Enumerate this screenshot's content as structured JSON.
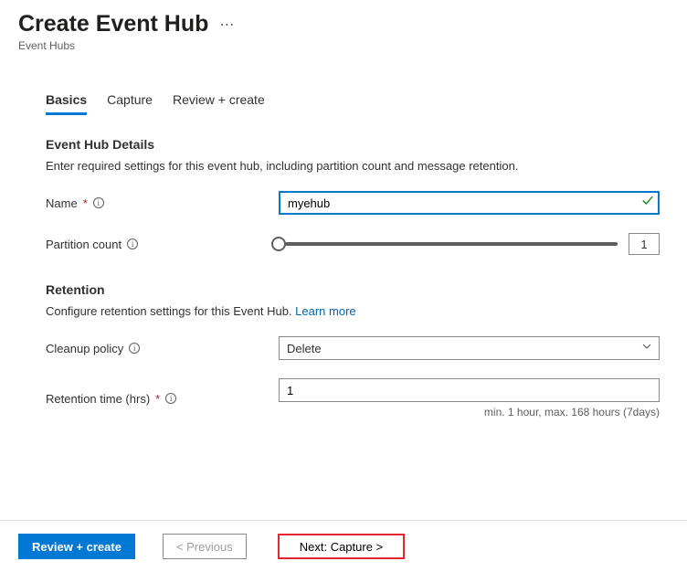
{
  "header": {
    "title": "Create Event Hub",
    "subtitle": "Event Hubs",
    "more": "⋯"
  },
  "tabs": [
    {
      "label": "Basics",
      "active": true
    },
    {
      "label": "Capture",
      "active": false
    },
    {
      "label": "Review + create",
      "active": false
    }
  ],
  "details": {
    "section_title": "Event Hub Details",
    "section_desc": "Enter required settings for this event hub, including partition count and message retention.",
    "name_label": "Name",
    "name_value": "myehub",
    "partition_label": "Partition count",
    "partition_value": "1"
  },
  "retention": {
    "section_title": "Retention",
    "section_desc_prefix": "Configure retention settings for this Event Hub. ",
    "learn_more": "Learn more",
    "cleanup_label": "Cleanup policy",
    "cleanup_value": "Delete",
    "time_label": "Retention time (hrs)",
    "time_value": "1",
    "hint": "min. 1 hour, max. 168 hours (7days)"
  },
  "footer": {
    "review": "Review + create",
    "previous": "< Previous",
    "next": "Next: Capture >"
  }
}
